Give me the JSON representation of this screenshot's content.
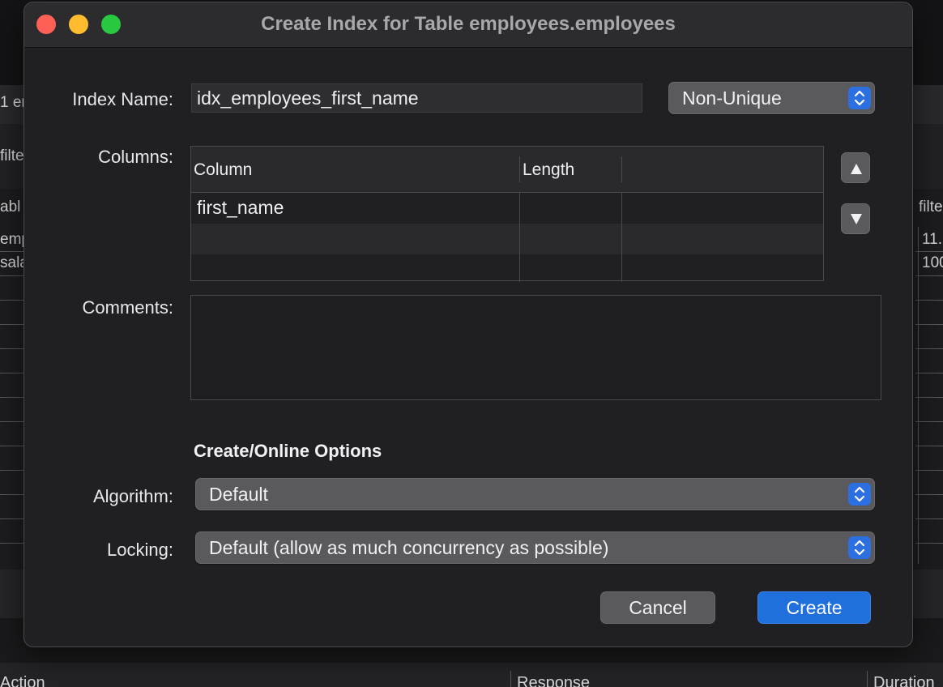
{
  "background": {
    "left_fragments": [
      "1 er",
      "filte",
      "abl",
      "emp",
      "sala"
    ],
    "right_fragments": [
      "filte",
      "11.",
      "100"
    ],
    "bottom_headers": [
      "Action",
      "Response",
      "Duration"
    ]
  },
  "dialog": {
    "title": "Create Index for Table employees.employees",
    "index_name_label": "Index Name:",
    "index_name_value": "idx_employees_first_name",
    "uniqueness_value": "Non-Unique",
    "columns_label": "Columns:",
    "columns_table": {
      "headers": [
        "Column",
        "Length"
      ],
      "rows": [
        {
          "column": "first_name",
          "length": ""
        },
        {
          "column": "",
          "length": ""
        },
        {
          "column": "",
          "length": ""
        }
      ]
    },
    "comments_label": "Comments:",
    "comments_value": "",
    "options_title": "Create/Online Options",
    "algorithm_label": "Algorithm:",
    "algorithm_value": "Default",
    "locking_label": "Locking:",
    "locking_value": "Default (allow as much concurrency as possible)",
    "cancel_label": "Cancel",
    "create_label": "Create"
  },
  "colors": {
    "accent": "#1f6fdc",
    "close": "#fe5f57",
    "minimize": "#febc2e",
    "maximize": "#28c840"
  },
  "icons": [
    "up-arrow-icon",
    "down-arrow-icon",
    "stepper-chevrons-icon"
  ]
}
